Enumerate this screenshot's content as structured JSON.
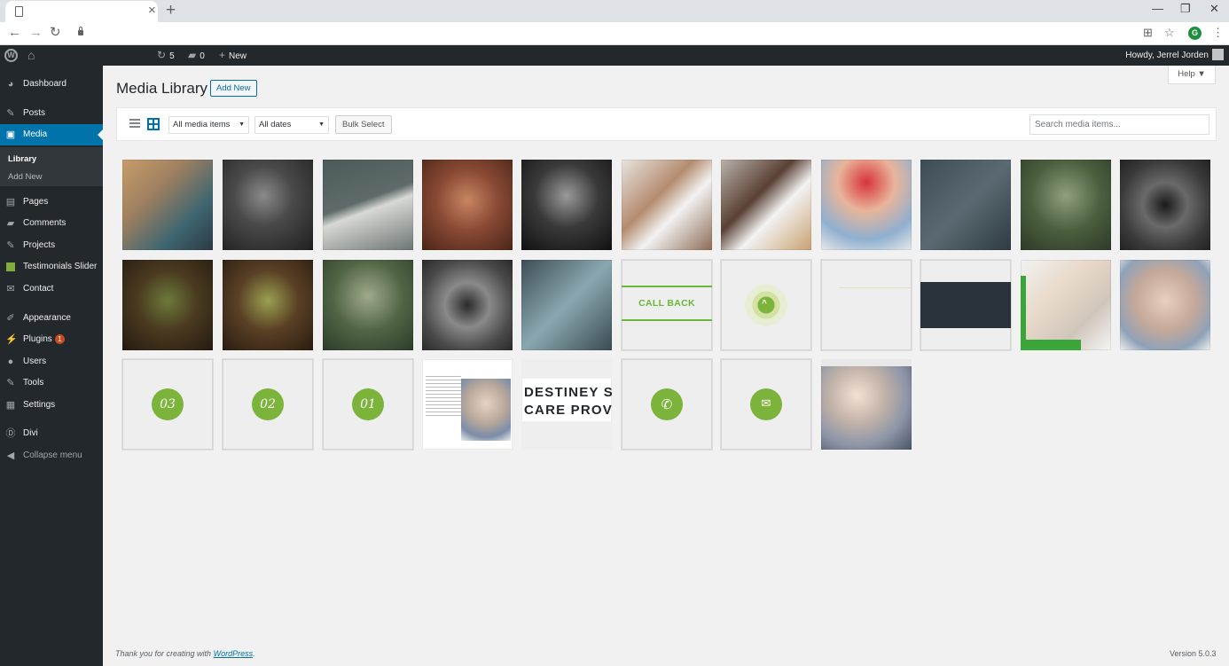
{
  "browser": {
    "win_minimize": "—",
    "win_restore": "❐",
    "win_close": "✕",
    "profile_initial": "G"
  },
  "adminbar": {
    "updates_count": "5",
    "comments_count": "0",
    "new_label": "New",
    "howdy": "Howdy, Jerrel Jorden"
  },
  "sidebar": {
    "items": [
      {
        "label": "Dashboard",
        "icon": "dashboard-icon"
      },
      {
        "label": "Posts",
        "icon": "pin-icon"
      },
      {
        "label": "Media",
        "icon": "media-icon"
      },
      {
        "label": "Pages",
        "icon": "page-icon"
      },
      {
        "label": "Comments",
        "icon": "comment-icon"
      },
      {
        "label": "Projects",
        "icon": "pin-icon"
      },
      {
        "label": "Testimonials Slider",
        "icon": "slider-icon"
      },
      {
        "label": "Contact",
        "icon": "mail-icon"
      },
      {
        "label": "Appearance",
        "icon": "brush-icon"
      },
      {
        "label": "Plugins",
        "icon": "plugin-icon",
        "badge": "1"
      },
      {
        "label": "Users",
        "icon": "user-icon"
      },
      {
        "label": "Tools",
        "icon": "wrench-icon"
      },
      {
        "label": "Settings",
        "icon": "settings-icon"
      },
      {
        "label": "Divi",
        "icon": "divi-icon"
      },
      {
        "label": "Collapse menu",
        "icon": "collapse-icon"
      }
    ],
    "submenu": [
      "Library",
      "Add New"
    ]
  },
  "page": {
    "title": "Media Library",
    "add_new": "Add New",
    "help": "Help ▼"
  },
  "filters": {
    "media_type": "All media items",
    "dates": "All dates",
    "bulk_select": "Bulk Select",
    "search_placeholder": "Search media items..."
  },
  "tiles": {
    "callback_text": "CALL BACK",
    "num_03": "03",
    "num_02": "02",
    "num_01": "01",
    "destiney_line1": "DESTINEY S",
    "destiney_line2": "CARE PROV"
  },
  "footer": {
    "thanks": "Thank you for creating with",
    "wordpress": "WordPress",
    "version": "Version 5.0.3"
  },
  "colors": {
    "admin_dark": "#23282d",
    "accent_blue": "#0073aa",
    "brand_green": "#7cb33a"
  }
}
